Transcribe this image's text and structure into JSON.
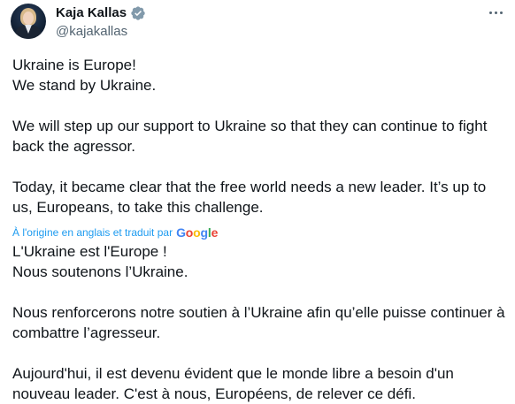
{
  "author": {
    "display_name": "Kaja Kallas",
    "handle": "@kajakallas"
  },
  "icons": {
    "verified": "verified-badge-icon",
    "more": "more-options-icon"
  },
  "colors": {
    "text": "#0f1419",
    "secondary": "#536471",
    "link": "#1d9bf0"
  },
  "original": {
    "line1": "Ukraine is Europe!",
    "line2": "We stand by Ukraine.",
    "para2": "We will step up our support to Ukraine so that they can continue to fight back the agressor.",
    "para3": "Today, it became clear that the free world needs a new leader. It’s up to us, Europeans, to take this challenge."
  },
  "translation_notice": {
    "label": "À l'origine en anglais et traduit par",
    "brand": [
      "G",
      "o",
      "o",
      "g",
      "l",
      "e"
    ]
  },
  "translated": {
    "line1": "L'Ukraine est l'Europe !",
    "line2": "Nous soutenons l’Ukraine.",
    "para2": "Nous renforcerons notre soutien à l’Ukraine afin qu’elle puisse continuer à combattre l’agresseur.",
    "para3": "Aujourd'hui, il est devenu évident que le monde libre a besoin d'un nouveau leader. C'est à nous, Européens, de relever ce défi."
  }
}
